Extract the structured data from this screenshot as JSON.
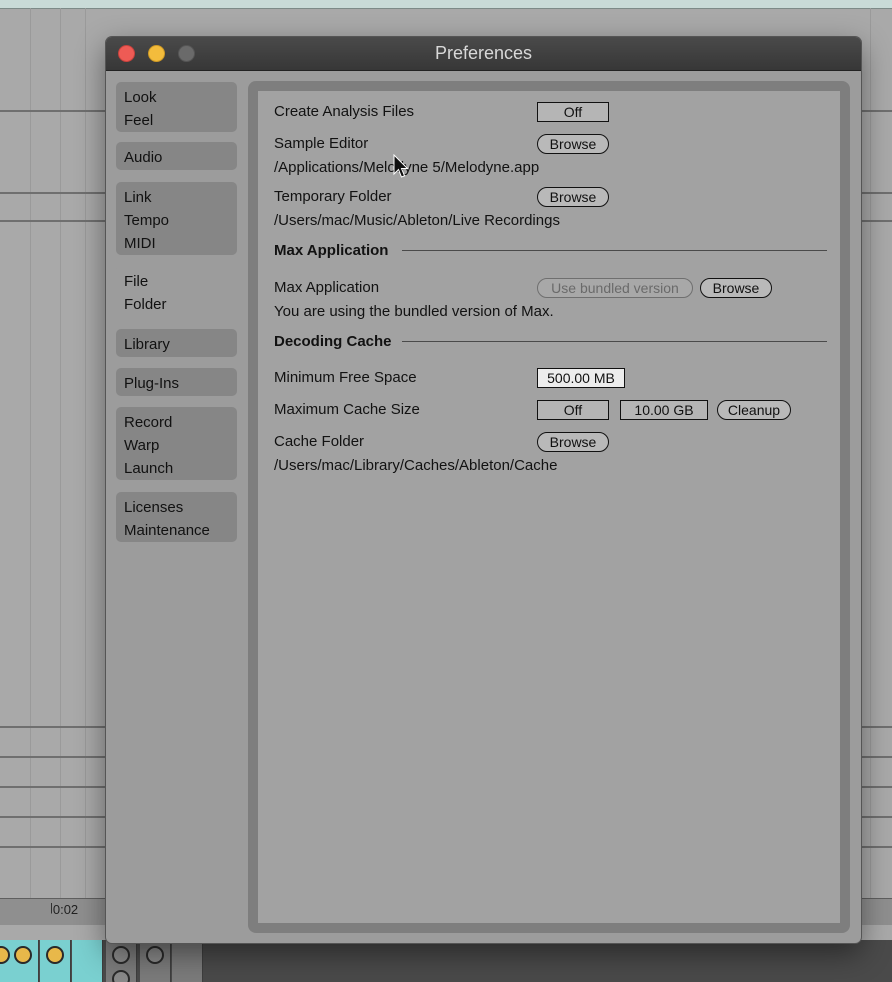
{
  "background": {
    "time_label": "0:02"
  },
  "window": {
    "title": "Preferences"
  },
  "sidebar": {
    "tabs": [
      {
        "lines": [
          "Look",
          "Feel"
        ]
      },
      {
        "lines": [
          "Audio"
        ]
      },
      {
        "lines": [
          "Link",
          "Tempo",
          "MIDI"
        ]
      },
      {
        "lines": [
          "File",
          "Folder"
        ]
      },
      {
        "lines": [
          "Library"
        ]
      },
      {
        "lines": [
          "Plug-Ins"
        ]
      },
      {
        "lines": [
          "Record",
          "Warp",
          "Launch"
        ]
      },
      {
        "lines": [
          "Licenses",
          "Maintenance"
        ]
      }
    ],
    "active_tab": "File Folder"
  },
  "file_folder": {
    "create_analysis_files": {
      "label": "Create Analysis Files",
      "value": "Off"
    },
    "sample_editor": {
      "label": "Sample Editor",
      "button": "Browse",
      "path": "/Applications/Melodyne 5/Melodyne.app"
    },
    "temporary_folder": {
      "label": "Temporary Folder",
      "button": "Browse",
      "path": "/Users/mac/Music/Ableton/Live Recordings"
    },
    "max_section": {
      "heading": "Max Application",
      "label": "Max Application",
      "bundled_button": "Use bundled version",
      "browse_button": "Browse",
      "note": "You are using the bundled version of Max."
    },
    "decoding_cache": {
      "heading": "Decoding Cache",
      "min_free_space": {
        "label": "Minimum Free Space",
        "value": "500.00 MB"
      },
      "max_cache_size": {
        "label": "Maximum Cache Size",
        "toggle": "Off",
        "value": "10.00 GB",
        "cleanup_button": "Cleanup"
      },
      "cache_folder": {
        "label": "Cache Folder",
        "button": "Browse",
        "path": "/Users/mac/Library/Caches/Ableton/Cache"
      }
    }
  },
  "colors": {
    "close": "#ee5b55",
    "minimize": "#f3bc3c",
    "zoom": "#6a6a6a",
    "clip": "#7ad0d0",
    "clip_led": "#e8b84a"
  }
}
